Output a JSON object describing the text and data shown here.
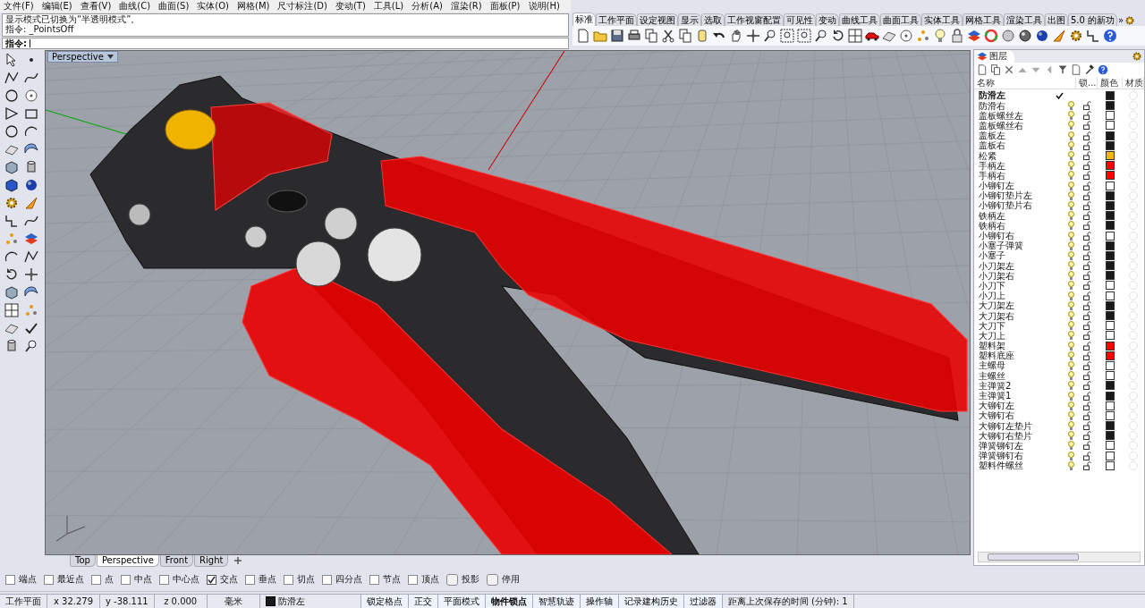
{
  "menu": [
    "文件(F)",
    "编辑(E)",
    "查看(V)",
    "曲线(C)",
    "曲面(S)",
    "实体(O)",
    "网格(M)",
    "尺寸标注(D)",
    "变动(T)",
    "工具(L)",
    "分析(A)",
    "渲染(R)",
    "面板(P)",
    "说明(H)"
  ],
  "command": {
    "history": [
      "显示模式已切换为“半透明模式”。",
      "指令: _PointsOff"
    ],
    "prompt": "指令:"
  },
  "toolbar_tabs": [
    {
      "label": "标准",
      "selected": true
    },
    {
      "label": "工作平面",
      "selected": false
    },
    {
      "label": "设定视图",
      "selected": false
    },
    {
      "label": "显示",
      "selected": false
    },
    {
      "label": "选取",
      "selected": false
    },
    {
      "label": "工作视窗配置",
      "selected": false
    },
    {
      "label": "可见性",
      "selected": false
    },
    {
      "label": "变动",
      "selected": false
    },
    {
      "label": "曲线工具",
      "selected": false
    },
    {
      "label": "曲面工具",
      "selected": false
    },
    {
      "label": "实体工具",
      "selected": false
    },
    {
      "label": "网格工具",
      "selected": false
    },
    {
      "label": "渲染工具",
      "selected": false
    },
    {
      "label": "出图",
      "selected": false
    },
    {
      "label": "5.0 的新功",
      "selected": false
    }
  ],
  "toolbar_more": "»",
  "viewport": {
    "title": "Perspective"
  },
  "view_tabs": [
    {
      "label": "Top",
      "selected": false
    },
    {
      "label": "Perspective",
      "selected": true
    },
    {
      "label": "Front",
      "selected": false
    },
    {
      "label": "Right",
      "selected": false
    }
  ],
  "layers": {
    "title": "图层",
    "columns": [
      "名称",
      "锁...",
      "颜色",
      "材质"
    ],
    "rows": [
      {
        "name": "防滑左",
        "current": true,
        "color": "#1a1a1a"
      },
      {
        "name": "防滑右",
        "current": false,
        "color": "#1a1a1a"
      },
      {
        "name": "盖板螺丝左",
        "current": false,
        "color": "#ffffff"
      },
      {
        "name": "盖板螺丝右",
        "current": false,
        "color": "#ffffff"
      },
      {
        "name": "盖板左",
        "current": false,
        "color": "#1a1a1a"
      },
      {
        "name": "盖板右",
        "current": false,
        "color": "#1a1a1a"
      },
      {
        "name": "松紧",
        "current": false,
        "color": "#f5b800"
      },
      {
        "name": "手柄左",
        "current": false,
        "color": "#ff0000"
      },
      {
        "name": "手柄右",
        "current": false,
        "color": "#ff0000"
      },
      {
        "name": "小铆钉左",
        "current": false,
        "color": "#ffffff"
      },
      {
        "name": "小铆钉垫片左",
        "current": false,
        "color": "#1a1a1a"
      },
      {
        "name": "小铆钉垫片右",
        "current": false,
        "color": "#1a1a1a"
      },
      {
        "name": "铁柄左",
        "current": false,
        "color": "#1a1a1a"
      },
      {
        "name": "铁柄右",
        "current": false,
        "color": "#1a1a1a"
      },
      {
        "name": "小铆钉右",
        "current": false,
        "color": "#ffffff"
      },
      {
        "name": "小塞子弹簧",
        "current": false,
        "color": "#1a1a1a"
      },
      {
        "name": "小塞子",
        "current": false,
        "color": "#1a1a1a"
      },
      {
        "name": "小刀架左",
        "current": false,
        "color": "#1a1a1a"
      },
      {
        "name": "小刀架右",
        "current": false,
        "color": "#1a1a1a"
      },
      {
        "name": "小刀下",
        "current": false,
        "color": "#ffffff"
      },
      {
        "name": "小刀上",
        "current": false,
        "color": "#ffffff"
      },
      {
        "name": "大刀架左",
        "current": false,
        "color": "#1a1a1a"
      },
      {
        "name": "大刀架右",
        "current": false,
        "color": "#1a1a1a"
      },
      {
        "name": "大刀下",
        "current": false,
        "color": "#ffffff"
      },
      {
        "name": "大刀上",
        "current": false,
        "color": "#ffffff"
      },
      {
        "name": "塑料架",
        "current": false,
        "color": "#ff0000"
      },
      {
        "name": "塑料底座",
        "current": false,
        "color": "#ff0000"
      },
      {
        "name": "主螺母",
        "current": false,
        "color": "#ffffff"
      },
      {
        "name": "主螺丝",
        "current": false,
        "color": "#ffffff"
      },
      {
        "name": "主弹簧2",
        "current": false,
        "color": "#1a1a1a"
      },
      {
        "name": "主弹簧1",
        "current": false,
        "color": "#1a1a1a"
      },
      {
        "name": "大铆钉左",
        "current": false,
        "color": "#ffffff"
      },
      {
        "name": "大铆钉右",
        "current": false,
        "color": "#ffffff"
      },
      {
        "name": "大铆钉左垫片",
        "current": false,
        "color": "#1a1a1a"
      },
      {
        "name": "大铆钉右垫片",
        "current": false,
        "color": "#1a1a1a"
      },
      {
        "name": "弹簧铆钉左",
        "current": false,
        "color": "#ffffff"
      },
      {
        "name": "弹簧铆钉右",
        "current": false,
        "color": "#ffffff"
      },
      {
        "name": "塑料件螺丝",
        "current": false,
        "color": "#ffffff"
      }
    ]
  },
  "osnaps": [
    {
      "label": "端点",
      "kind": "checkbox",
      "checked": false
    },
    {
      "label": "最近点",
      "kind": "checkbox",
      "checked": false
    },
    {
      "label": "点",
      "kind": "checkbox",
      "checked": false
    },
    {
      "label": "中点",
      "kind": "checkbox",
      "checked": false
    },
    {
      "label": "中心点",
      "kind": "checkbox",
      "checked": false
    },
    {
      "label": "交点",
      "kind": "checkbox",
      "checked": true
    },
    {
      "label": "垂点",
      "kind": "checkbox",
      "checked": false
    },
    {
      "label": "切点",
      "kind": "checkbox",
      "checked": false
    },
    {
      "label": "四分点",
      "kind": "checkbox",
      "checked": false
    },
    {
      "label": "节点",
      "kind": "checkbox",
      "checked": false
    },
    {
      "label": "顶点",
      "kind": "checkbox",
      "checked": false
    },
    {
      "label": "投影",
      "kind": "toggle",
      "checked": false
    },
    {
      "label": "停用",
      "kind": "toggle",
      "checked": false
    }
  ],
  "status_bar": [
    {
      "text": "工作平面",
      "kind": "plain"
    },
    {
      "text": "x 32.279",
      "kind": "coord"
    },
    {
      "text": "y -38.111",
      "kind": "coord"
    },
    {
      "text": "z 0.000",
      "kind": "coord"
    },
    {
      "text": "毫米",
      "kind": "coord"
    },
    {
      "text": "防滑左",
      "kind": "layer",
      "color": "#1a1a1a"
    },
    {
      "text": "锁定格点",
      "kind": "toggle",
      "on": false
    },
    {
      "text": "正交",
      "kind": "toggle",
      "on": false
    },
    {
      "text": "平面模式",
      "kind": "toggle",
      "on": false
    },
    {
      "text": "物件锁点",
      "kind": "toggle",
      "on": true
    },
    {
      "text": "智慧轨迹",
      "kind": "toggle",
      "on": false
    },
    {
      "text": "操作轴",
      "kind": "toggle",
      "on": false
    },
    {
      "text": "记录建构历史",
      "kind": "toggle",
      "on": false
    },
    {
      "text": "过滤器",
      "kind": "toggle",
      "on": false
    },
    {
      "text": "距离上次保存的时间 (分钟): 1",
      "kind": "plain"
    }
  ]
}
